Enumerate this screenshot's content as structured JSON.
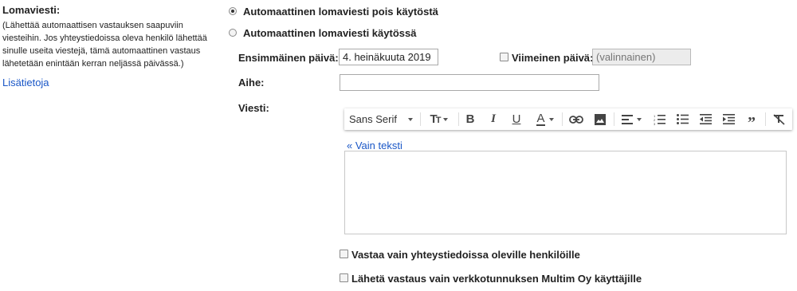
{
  "left": {
    "title": "Lomaviesti:",
    "description": "(Lähettää automaattisen vastauksen saapuviin viesteihin. Jos yhteystiedoissa oleva henkilö lähettää sinulle useita viestejä, tämä automaattinen vastaus lähetetään enintään kerran neljässä päivässä.)",
    "learn_more": "Lisätietoja"
  },
  "options": {
    "off_label": "Automaattinen lomaviesti pois käytöstä",
    "on_label": "Automaattinen lomaviesti käytössä",
    "selected": "off"
  },
  "dates": {
    "first_label": "Ensimmäinen päivä:",
    "first_value": "4. heinäkuuta 2019",
    "last_label": "Viimeinen päivä:",
    "last_placeholder": "(valinnainen)"
  },
  "subject": {
    "label": "Aihe:",
    "value": ""
  },
  "message": {
    "label": "Viesti:",
    "font_name": "Sans Serif",
    "plain_text_link": "« Vain teksti",
    "body": ""
  },
  "toolbar_icons": [
    "font-size-icon",
    "bold-icon",
    "italic-icon",
    "underline-icon",
    "text-color-icon",
    "link-icon",
    "image-icon",
    "align-icon",
    "numbered-list-icon",
    "bulleted-list-icon",
    "indent-less-icon",
    "indent-more-icon",
    "quote-icon",
    "remove-formatting-icon"
  ],
  "checkboxes": {
    "contacts_only": "Vastaa vain yhteystiedoissa oleville henkilöille",
    "domain_only": "Lähetä vastaus vain verkkotunnuksen Multim Oy käyttäjille"
  },
  "colors": {
    "link": "#1a57c7",
    "text": "#222222"
  }
}
